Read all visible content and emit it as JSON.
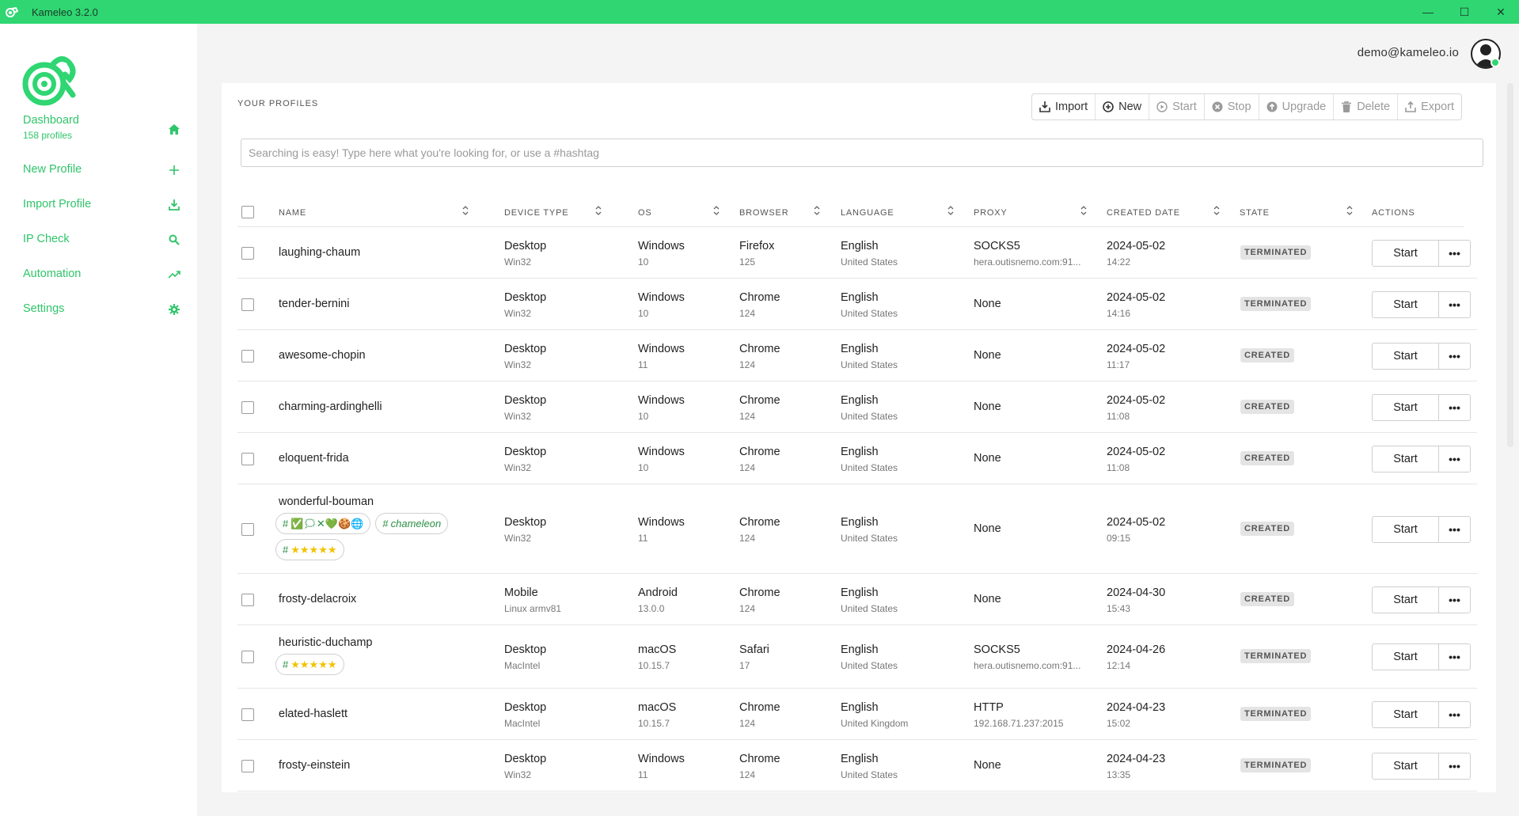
{
  "window": {
    "title": "Kameleo 3.2.0",
    "controls": {
      "minimize": "—",
      "maximize": "☐",
      "close": "✕"
    }
  },
  "sidebar": {
    "items": [
      {
        "label": "Dashboard",
        "sub": "158 profiles",
        "icon": "home-icon"
      },
      {
        "label": "New Profile",
        "icon": "plus-icon"
      },
      {
        "label": "Import Profile",
        "icon": "download-icon"
      },
      {
        "label": "IP Check",
        "icon": "search-icon"
      },
      {
        "label": "Automation",
        "icon": "trending-icon"
      },
      {
        "label": "Settings",
        "icon": "gear-icon"
      }
    ],
    "accent": "#2fc56a"
  },
  "header": {
    "user_email": "demo@kameleo.io"
  },
  "main": {
    "title": "YOUR PROFILES",
    "toolbar": {
      "import": "Import",
      "new": "New",
      "start": "Start",
      "stop": "Stop",
      "upgrade": "Upgrade",
      "delete": "Delete",
      "export": "Export"
    },
    "search": {
      "placeholder": "Searching is easy! Type here what you're looking for, or use a #hashtag",
      "value": ""
    },
    "columns": [
      "NAME",
      "DEVICE TYPE",
      "OS",
      "BROWSER",
      "LANGUAGE",
      "PROXY",
      "CREATED DATE",
      "STATE",
      "ACTIONS"
    ],
    "rows": [
      {
        "name": "laughing-chaum",
        "device": "Desktop",
        "device_sub": "Win32",
        "os": "Windows",
        "os_sub": "10",
        "browser": "Firefox",
        "browser_sub": "125",
        "language": "English",
        "language_sub": "United States",
        "proxy": "SOCKS5",
        "proxy_sub": "hera.outisnemo.com:91...",
        "date": "2024-05-02",
        "time": "14:22",
        "state": "TERMINATED",
        "start": "Start",
        "more": "•••"
      },
      {
        "name": "tender-bernini",
        "device": "Desktop",
        "device_sub": "Win32",
        "os": "Windows",
        "os_sub": "10",
        "browser": "Chrome",
        "browser_sub": "124",
        "language": "English",
        "language_sub": "United States",
        "proxy": "None",
        "proxy_sub": "",
        "date": "2024-05-02",
        "time": "14:16",
        "state": "TERMINATED",
        "start": "Start",
        "more": "•••"
      },
      {
        "name": "awesome-chopin",
        "device": "Desktop",
        "device_sub": "Win32",
        "os": "Windows",
        "os_sub": "11",
        "browser": "Chrome",
        "browser_sub": "124",
        "language": "English",
        "language_sub": "United States",
        "proxy": "None",
        "proxy_sub": "",
        "date": "2024-05-02",
        "time": "11:17",
        "state": "CREATED",
        "start": "Start",
        "more": "•••"
      },
      {
        "name": "charming-ardinghelli",
        "device": "Desktop",
        "device_sub": "Win32",
        "os": "Windows",
        "os_sub": "10",
        "browser": "Chrome",
        "browser_sub": "124",
        "language": "English",
        "language_sub": "United States",
        "proxy": "None",
        "proxy_sub": "",
        "date": "2024-05-02",
        "time": "11:08",
        "state": "CREATED",
        "start": "Start",
        "more": "•••"
      },
      {
        "name": "eloquent-frida",
        "device": "Desktop",
        "device_sub": "Win32",
        "os": "Windows",
        "os_sub": "10",
        "browser": "Chrome",
        "browser_sub": "124",
        "language": "English",
        "language_sub": "United States",
        "proxy": "None",
        "proxy_sub": "",
        "date": "2024-05-02",
        "time": "11:08",
        "state": "CREATED",
        "start": "Start",
        "more": "•••"
      },
      {
        "name": "wonderful-bouman",
        "device": "Desktop",
        "device_sub": "Win32",
        "os": "Windows",
        "os_sub": "11",
        "browser": "Chrome",
        "browser_sub": "124",
        "language": "English",
        "language_sub": "United States",
        "proxy": "None",
        "proxy_sub": "",
        "date": "2024-05-02",
        "time": "09:15",
        "state": "CREATED",
        "start": "Start",
        "more": "•••",
        "tags": [
          {
            "hash": "#",
            "text": "✅🗯✕💚🍪🌐"
          },
          {
            "hash": "#",
            "text": "chameleon"
          },
          {
            "hash": "#",
            "text": "★★★★★"
          }
        ]
      },
      {
        "name": "frosty-delacroix",
        "device": "Mobile",
        "device_sub": "Linux armv81",
        "os": "Android",
        "os_sub": "13.0.0",
        "browser": "Chrome",
        "browser_sub": "124",
        "language": "English",
        "language_sub": "United States",
        "proxy": "None",
        "proxy_sub": "",
        "date": "2024-04-30",
        "time": "15:43",
        "state": "CREATED",
        "start": "Start",
        "more": "•••"
      },
      {
        "name": "heuristic-duchamp",
        "device": "Desktop",
        "device_sub": "MacIntel",
        "os": "macOS",
        "os_sub": "10.15.7",
        "browser": "Safari",
        "browser_sub": "17",
        "language": "English",
        "language_sub": "United States",
        "proxy": "SOCKS5",
        "proxy_sub": "hera.outisnemo.com:91...",
        "date": "2024-04-26",
        "time": "12:14",
        "state": "TERMINATED",
        "start": "Start",
        "more": "•••",
        "tags": [
          {
            "hash": "#",
            "text": "★★★★★"
          }
        ]
      },
      {
        "name": "elated-haslett",
        "device": "Desktop",
        "device_sub": "MacIntel",
        "os": "macOS",
        "os_sub": "10.15.7",
        "browser": "Chrome",
        "browser_sub": "124",
        "language": "English",
        "language_sub": "United Kingdom",
        "proxy": "HTTP",
        "proxy_sub": "192.168.71.237:2015",
        "date": "2024-04-23",
        "time": "15:02",
        "state": "TERMINATED",
        "start": "Start",
        "more": "•••"
      },
      {
        "name": "frosty-einstein",
        "device": "Desktop",
        "device_sub": "Win32",
        "os": "Windows",
        "os_sub": "11",
        "browser": "Chrome",
        "browser_sub": "124",
        "language": "English",
        "language_sub": "United States",
        "proxy": "None",
        "proxy_sub": "",
        "date": "2024-04-23",
        "time": "13:35",
        "state": "TERMINATED",
        "start": "Start",
        "more": "•••"
      }
    ]
  }
}
